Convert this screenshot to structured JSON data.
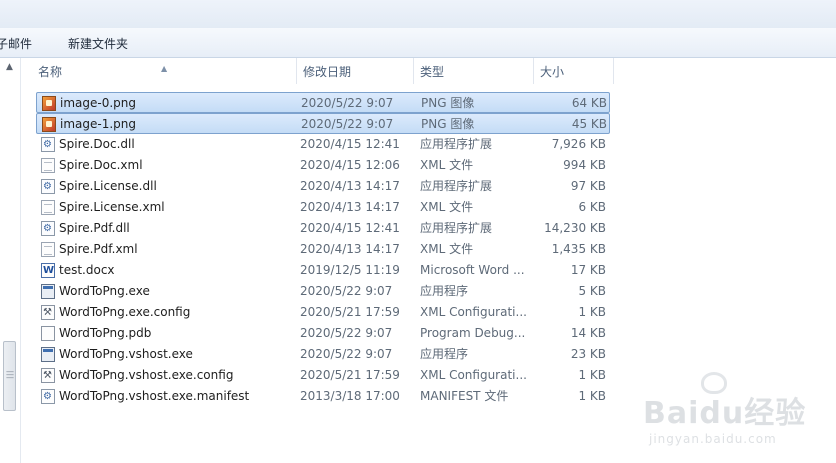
{
  "toolbar": {
    "email_label": "子邮件",
    "new_folder_label": "新建文件夹"
  },
  "columns": {
    "name": "名称",
    "date": "修改日期",
    "type": "类型",
    "size": "大小"
  },
  "files": [
    {
      "name": "image-0.png",
      "date": "2020/5/22 9:07",
      "type": "PNG 图像",
      "size": "64 KB",
      "icon": "png-file-icon",
      "selected": true
    },
    {
      "name": "image-1.png",
      "date": "2020/5/22 9:07",
      "type": "PNG 图像",
      "size": "45 KB",
      "icon": "png-file-icon",
      "selected": true
    },
    {
      "name": "Spire.Doc.dll",
      "date": "2020/4/15 12:41",
      "type": "应用程序扩展",
      "size": "7,926 KB",
      "icon": "dll-file-icon"
    },
    {
      "name": "Spire.Doc.xml",
      "date": "2020/4/15 12:06",
      "type": "XML 文件",
      "size": "994 KB",
      "icon": "xml-file-icon"
    },
    {
      "name": "Spire.License.dll",
      "date": "2020/4/13 14:17",
      "type": "应用程序扩展",
      "size": "97 KB",
      "icon": "dll-file-icon"
    },
    {
      "name": "Spire.License.xml",
      "date": "2020/4/13 14:17",
      "type": "XML 文件",
      "size": "6 KB",
      "icon": "xml-file-icon"
    },
    {
      "name": "Spire.Pdf.dll",
      "date": "2020/4/15 12:41",
      "type": "应用程序扩展",
      "size": "14,230 KB",
      "icon": "dll-file-icon"
    },
    {
      "name": "Spire.Pdf.xml",
      "date": "2020/4/13 14:17",
      "type": "XML 文件",
      "size": "1,435 KB",
      "icon": "xml-file-icon"
    },
    {
      "name": "test.docx",
      "date": "2019/12/5 11:19",
      "type": "Microsoft Word ...",
      "size": "17 KB",
      "icon": "word-doc-icon"
    },
    {
      "name": "WordToPng.exe",
      "date": "2020/5/22 9:07",
      "type": "应用程序",
      "size": "5 KB",
      "icon": "exe-file-icon"
    },
    {
      "name": "WordToPng.exe.config",
      "date": "2020/5/21 17:59",
      "type": "XML Configurati...",
      "size": "1 KB",
      "icon": "config-file-icon"
    },
    {
      "name": "WordToPng.pdb",
      "date": "2020/5/22 9:07",
      "type": "Program Debug...",
      "size": "14 KB",
      "icon": "pdb-file-icon"
    },
    {
      "name": "WordToPng.vshost.exe",
      "date": "2020/5/22 9:07",
      "type": "应用程序",
      "size": "23 KB",
      "icon": "exe-file-icon"
    },
    {
      "name": "WordToPng.vshost.exe.config",
      "date": "2020/5/21 17:59",
      "type": "XML Configurati...",
      "size": "1 KB",
      "icon": "config-file-icon"
    },
    {
      "name": "WordToPng.vshost.exe.manifest",
      "date": "2013/3/18 17:00",
      "type": "MANIFEST 文件",
      "size": "1 KB",
      "icon": "manifest-file-icon"
    }
  ],
  "watermark": {
    "brand": "Baidu经验",
    "url": "jingyan.baidu.com"
  },
  "colors": {
    "selection_fill": "#c4dcf6",
    "selection_border": "#7da2ce",
    "header_text": "#4c607a"
  }
}
